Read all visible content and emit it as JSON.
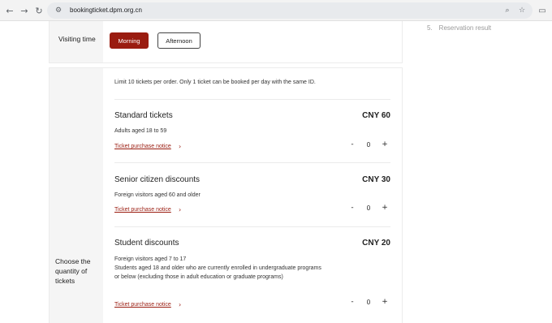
{
  "browser": {
    "url": "bookingticket.dpm.org.cn",
    "back_icon": "arrow-left-icon",
    "forward_icon": "arrow-right-icon",
    "reload_icon": "reload-icon",
    "zoom_icon": "zoom-icon",
    "bookmark_icon": "star-icon",
    "extension_icon": "extension-icon"
  },
  "visiting": {
    "label": "Visiting time",
    "options": [
      {
        "label": "Morning",
        "selected": true
      },
      {
        "label": "Afternoon",
        "selected": false
      }
    ]
  },
  "quantity": {
    "label": "Choose the quantity of tickets",
    "limit_text": "Limit 10 tickets per order. Only 1 ticket can be booked per day with the same ID.",
    "tickets": [
      {
        "name": "Standard tickets",
        "price": "CNY 60",
        "desc": [
          "Adults aged 18 to 59"
        ],
        "notice": "Ticket purchase notice",
        "count": "0"
      },
      {
        "name": "Senior citizen discounts",
        "price": "CNY 30",
        "desc": [
          "Foreign visitors aged 60 and older"
        ],
        "notice": "Ticket purchase notice",
        "count": "0"
      },
      {
        "name": "Student discounts",
        "price": "CNY 20",
        "desc": [
          "Foreign visitors aged 7 to 17",
          "Students aged 18 and older who are currently enrolled in undergraduate programs",
          "or below (excluding those in adult education or graduate programs)"
        ],
        "notice": "Ticket purchase notice",
        "count": "0"
      }
    ],
    "minus": "-",
    "plus": "+"
  },
  "steps": {
    "items": [
      {
        "num": "5.",
        "label": "Reservation result"
      }
    ]
  }
}
